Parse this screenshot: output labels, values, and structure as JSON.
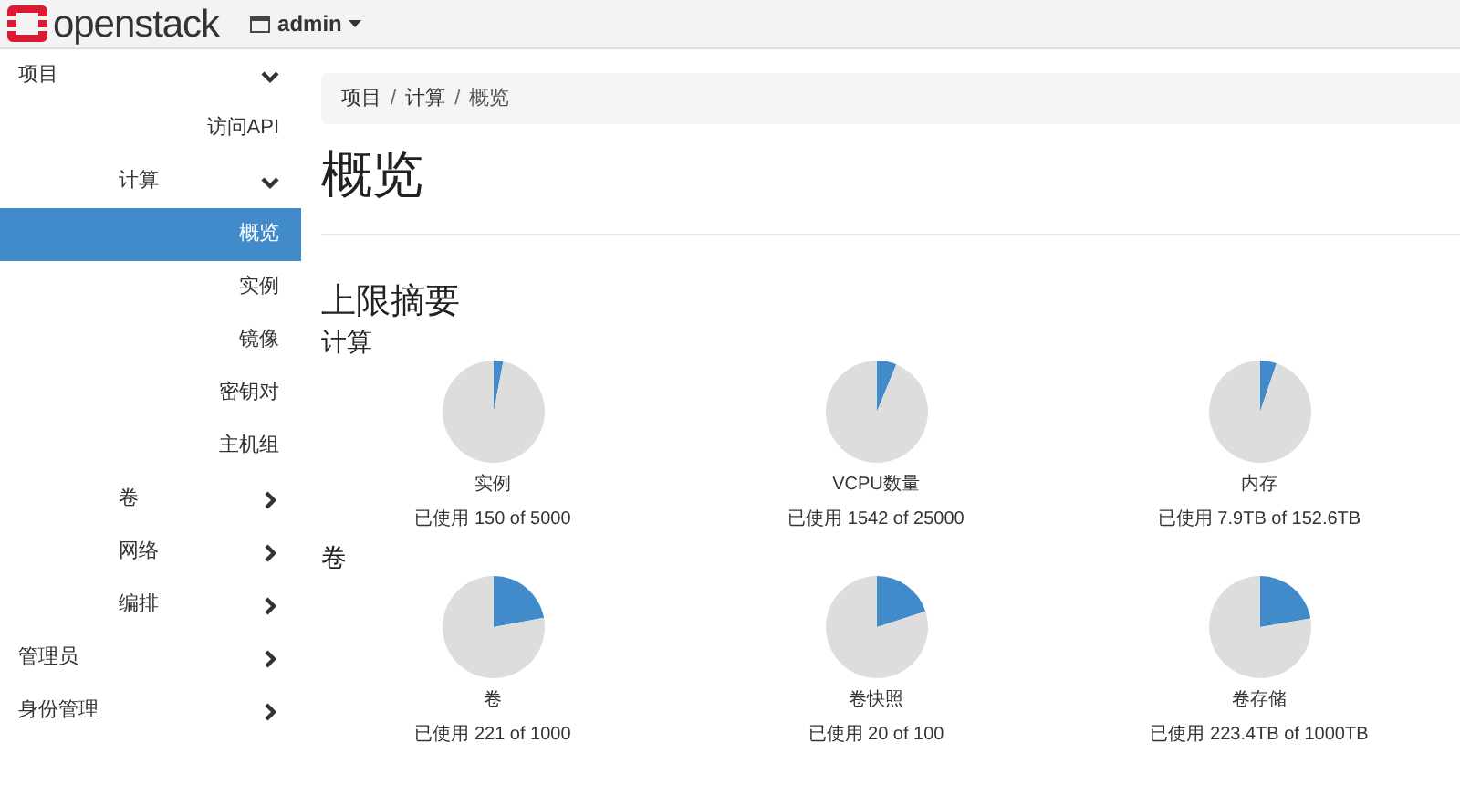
{
  "topbar": {
    "brand": "openstack",
    "project_menu": "admin"
  },
  "sidebar": {
    "items": [
      {
        "label": "项目",
        "expanded": true,
        "children": [
          {
            "label": "访问API",
            "selected": false
          },
          {
            "label": "计算",
            "expanded": true,
            "children": [
              {
                "label": "概览",
                "selected": true
              },
              {
                "label": "实例",
                "selected": false
              },
              {
                "label": "镜像",
                "selected": false
              },
              {
                "label": "密钥对",
                "selected": false
              },
              {
                "label": "主机组",
                "selected": false
              }
            ]
          },
          {
            "label": "卷",
            "expanded": false
          },
          {
            "label": "网络",
            "expanded": false
          },
          {
            "label": "编排",
            "expanded": false
          }
        ]
      },
      {
        "label": "管理员",
        "expanded": false
      },
      {
        "label": "身份管理",
        "expanded": false
      }
    ]
  },
  "breadcrumb": {
    "separator": "/",
    "items": [
      "项目",
      "计算",
      "概览"
    ]
  },
  "page_title": "概览",
  "section_title": "上限摘要",
  "groups": [
    {
      "title": "计算",
      "meters": [
        {
          "name": "实例",
          "usage": "已使用 150 of 5000",
          "chart_data": {
            "type": "pie",
            "values": [
              3,
              97
            ]
          }
        },
        {
          "name": "VCPU数量",
          "usage": "已使用 1542 of 25000",
          "chart_data": {
            "type": "pie",
            "values": [
              6.2,
              93.8
            ]
          }
        },
        {
          "name": "内存",
          "usage": "已使用 7.9TB of 152.6TB",
          "chart_data": {
            "type": "pie",
            "values": [
              5.2,
              94.8
            ]
          }
        }
      ]
    },
    {
      "title": "卷",
      "meters": [
        {
          "name": "卷",
          "usage": "已使用 221 of 1000",
          "chart_data": {
            "type": "pie",
            "values": [
              22.1,
              77.9
            ]
          }
        },
        {
          "name": "卷快照",
          "usage": "已使用 20 of 100",
          "chart_data": {
            "type": "pie",
            "values": [
              20,
              80
            ]
          }
        },
        {
          "name": "卷存储",
          "usage": "已使用 223.4TB of 1000TB",
          "chart_data": {
            "type": "pie",
            "values": [
              22.3,
              77.7
            ]
          }
        }
      ]
    }
  ]
}
